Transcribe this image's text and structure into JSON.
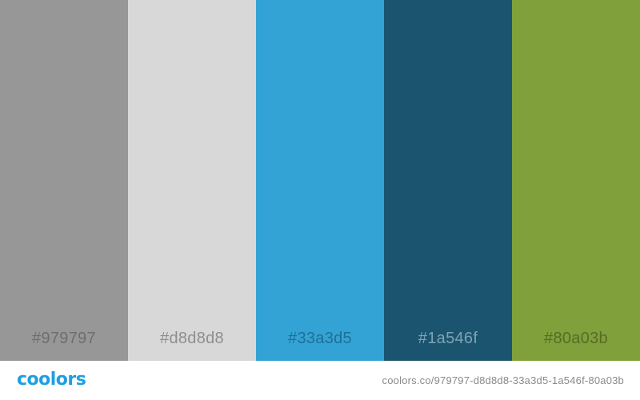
{
  "palette": {
    "swatches": [
      {
        "hex": "#979797",
        "label": "#979797",
        "label_color": "#6e6e6e"
      },
      {
        "hex": "#d8d8d8",
        "label": "#d8d8d8",
        "label_color": "#8e8e8e"
      },
      {
        "hex": "#33a3d5",
        "label": "#33a3d5",
        "label_color": "#1f6f94"
      },
      {
        "hex": "#1a546f",
        "label": "#1a546f",
        "label_color": "#7fa3b4"
      },
      {
        "hex": "#80a03b",
        "label": "#80a03b",
        "label_color": "#566c27"
      }
    ]
  },
  "footer": {
    "logo_text": "coolors",
    "logo_color": "#1d9fe3",
    "url_text": "coolors.co/979797-d8d8d8-33a3d5-1a546f-80a03b"
  }
}
